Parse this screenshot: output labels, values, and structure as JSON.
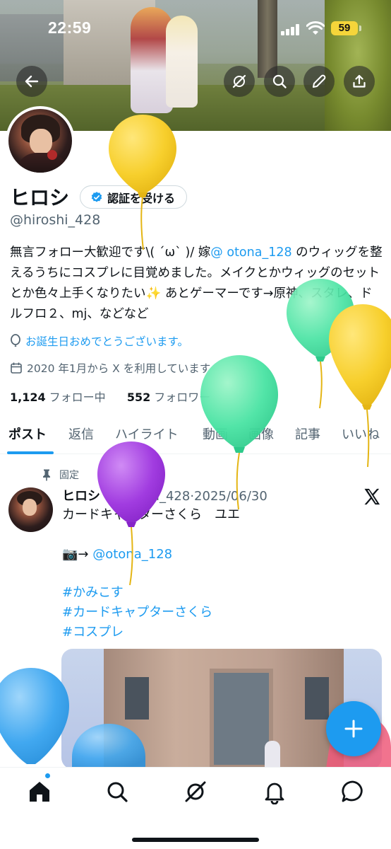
{
  "status_bar": {
    "time": "22:59",
    "battery": "59"
  },
  "profile": {
    "name": "ヒロシ",
    "verify_button": "認証を受ける",
    "handle": "@hiroshi_428",
    "bio_parts": {
      "p1": "無言フォロー大歓迎です\\( ´ω` )/ 嫁",
      "mention": "@ otona_128",
      "p2": " のウィッグを整えるうちにコスプレに目覚めました。メイクとかウィッグのセットとか色々上手くなりたい",
      "sparkle": "✨",
      "p3": " あとゲーマーです→原神、スタレ、ドルフロ２、mj、などなど"
    },
    "birthday_text": "お誕生日おめでとうございます。",
    "joined_text": "2020 年1月から X を利用しています",
    "following_count": "1,124",
    "following_label": "フォロー中",
    "followers_count": "552",
    "followers_label": "フォロワー"
  },
  "tabs": [
    "ポスト",
    "返信",
    "ハイライト",
    "動画",
    "画像",
    "記事",
    "いいね"
  ],
  "pinned_post": {
    "pinned_label": "固定",
    "author_name": "ヒロシ",
    "author_handle": "@hiroshi_428",
    "date": "2025/06/30",
    "line1": "カードキャプターさくら　ユエ",
    "camera": "📷→ ",
    "photo_credit": "@otona_128",
    "hashtags": [
      "#かみこす",
      "#カードキャプターさくら",
      "#コスプレ"
    ]
  },
  "colors": {
    "accent": "#1d9bf0",
    "text": "#0f1419",
    "muted": "#536471"
  },
  "icons": [
    "back-arrow-icon",
    "grok-icon",
    "search-icon",
    "edit-icon",
    "share-icon",
    "verified-badge-icon",
    "balloon-icon",
    "calendar-icon",
    "pin-icon",
    "x-logo-icon",
    "plus-icon",
    "home-icon",
    "search-icon",
    "grok-icon",
    "bell-icon",
    "messages-icon"
  ]
}
